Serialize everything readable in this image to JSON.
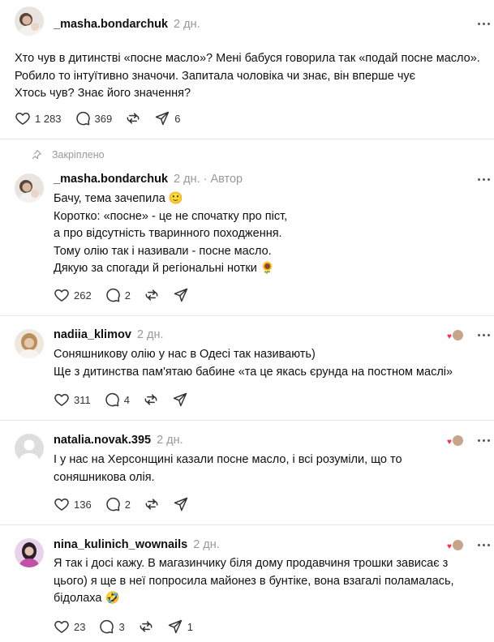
{
  "main_post": {
    "username": "_masha.bondarchuk",
    "time": "2 дн.",
    "lines": [
      "Хто чув в дитинстві «посне масло»? Мені бабуся говорила так «подай посне масло».",
      "Робило то інтуїтивно значочи. Запитала чоловіка чи знає, він вперше чує",
      "Хтось чув? Знає його значення?"
    ],
    "likes": "1 283",
    "comments": "369",
    "shares": "6"
  },
  "pinned_label": "Закріплено",
  "replies": [
    {
      "username": "_masha.bondarchuk",
      "time": "2 дн.",
      "separator": "·",
      "badge": "Автор",
      "lines": [
        "Бачу, тема зачепила 🙂",
        "Коротко: «посне» - це не спочатку про піст,",
        "а про відсутність тваринного походження.",
        "Тому олію так і називали - посне масло.",
        "Дякую за спогади й регіональні нотки 🌻"
      ],
      "likes": "262",
      "comments": "2",
      "reposts": ""
    },
    {
      "username": "nadiia_klimov",
      "time": "2 дн.",
      "lines": [
        "Соняшникову олію у нас в Одесі так називають)",
        "Ще з дитинства пам'ятаю бабине «та це якась єрунда на постном маслі»"
      ],
      "likes": "311",
      "comments": "4",
      "reposts": ""
    },
    {
      "username": "natalia.novak.395",
      "time": "2 дн.",
      "lines": [
        "І у нас на Херсонщині казали посне масло, і всі розуміли, що то",
        "соняшникова олія."
      ],
      "likes": "136",
      "comments": "2",
      "reposts": ""
    },
    {
      "username": "nina_kulinich_wownails",
      "time": "2 дн.",
      "lines": [
        "Я так і досі кажу. В магазинчику біля дому продавчиня трошки зависає з",
        "цього) я ще в неї попросила майонез в бунтіке, вона взагалі поламалась,",
        "бідолаха 🤣"
      ],
      "likes": "23",
      "comments": "3",
      "shares": "1"
    }
  ],
  "icons": {
    "like": "heart-icon",
    "comment": "comment-bubble-icon",
    "repost": "repost-icon",
    "share": "send-icon",
    "more": "more-options-icon",
    "pin": "pin-icon",
    "liked_by_author": "author-liked-heart-icon"
  },
  "colors": {
    "text": "#101010",
    "secondary": "#999999",
    "divider": "#e5e5e5",
    "liked_heart": "#ff2d55"
  }
}
